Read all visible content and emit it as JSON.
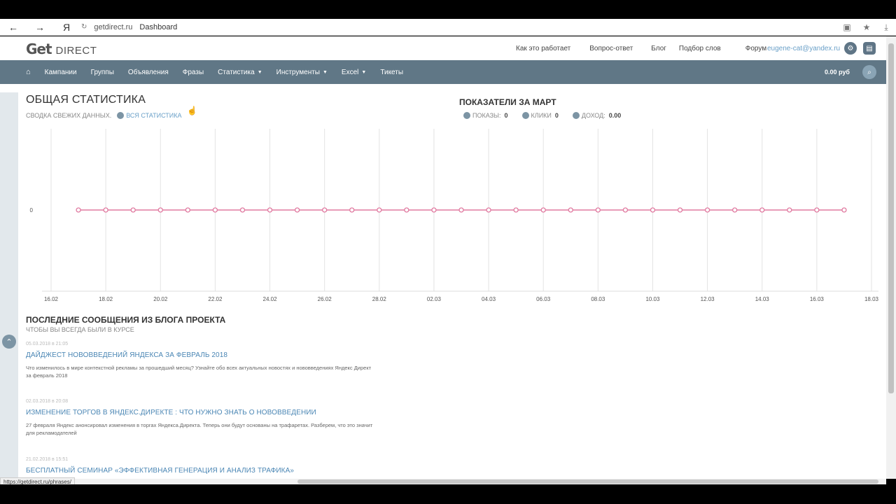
{
  "browser": {
    "back": "←",
    "forward": "→",
    "yandex": "Я",
    "domain": "getdirect.ru",
    "page_title": "Dashboard"
  },
  "logo": {
    "get": "Get",
    "direct": "DIRECT"
  },
  "toplinks": [
    "Как это работает",
    "Вопрос-ответ",
    "Блог",
    "Подбор слов",
    "Форум"
  ],
  "user_email": "eugene-cat@yandex.ru",
  "nav": {
    "items": [
      "Кампании",
      "Группы",
      "Объявления",
      "Фразы",
      "Статистика",
      "Инструменты",
      "Excel",
      "Тикеты"
    ],
    "balance": "0.00 руб"
  },
  "overview": {
    "title": "ОБЩАЯ СТАТИСТИКА",
    "subtitle": "СВОДКА СВЕЖИХ ДАННЫХ.",
    "all_stats_link": "ВСЯ СТАТИСТИКА"
  },
  "march": {
    "title": "ПОКАЗАТЕЛИ ЗА МАРТ",
    "shows_label": "ПОКАЗЫ:",
    "shows_value": "0",
    "clicks_label": "КЛИКИ",
    "clicks_value": "0",
    "income_label": "ДОХОД:",
    "income_value": "0.00"
  },
  "chart_data": {
    "type": "line",
    "x_ticks": [
      "16.02",
      "18.02",
      "20.02",
      "22.02",
      "24.02",
      "26.02",
      "28.02",
      "02.03",
      "04.03",
      "06.03",
      "08.03",
      "10.03",
      "12.03",
      "14.03",
      "16.03",
      "18.03"
    ],
    "x": [
      "17.02",
      "18.02",
      "19.02",
      "20.02",
      "21.02",
      "22.02",
      "23.02",
      "24.02",
      "25.02",
      "26.02",
      "27.02",
      "28.02",
      "01.03",
      "02.03",
      "03.03",
      "04.03",
      "05.03",
      "06.03",
      "07.03",
      "08.03",
      "09.03",
      "10.03",
      "11.03",
      "12.03",
      "13.03",
      "14.03",
      "15.03",
      "16.03",
      "17.03"
    ],
    "values": [
      0,
      0,
      0,
      0,
      0,
      0,
      0,
      0,
      0,
      0,
      0,
      0,
      0,
      0,
      0,
      0,
      0,
      0,
      0,
      0,
      0,
      0,
      0,
      0,
      0,
      0,
      0,
      0,
      0
    ],
    "y_ticks": [
      "0"
    ],
    "ylim": [
      -1,
      1
    ],
    "grid": true,
    "line_color": "#e07aa0"
  },
  "blog": {
    "title": "ПОСЛЕДНИЕ СООБЩЕНИЯ ИЗ БЛОГА ПРОЕКТА",
    "subtitle": "ЧТОБЫ ВЫ ВСЕГДА БЫЛИ В КУРСЕ",
    "posts": [
      {
        "date": "05.03.2018 в 21:05",
        "title": "ДАЙДЖЕСТ НОВОВВЕДЕНИЙ ЯНДЕКСА ЗА ФЕВРАЛЬ 2018",
        "text": "Что изменилось в мире контекстной рекламы за прошедший месяц? Узнайте обо всех актуальных новостях и нововведениях Яндекс Директ за февраль 2018"
      },
      {
        "date": "02.03.2018 в 20:08",
        "title": "ИЗМЕНЕНИЕ ТОРГОВ В ЯНДЕКС.ДИРЕКТЕ : ЧТО НУЖНО ЗНАТЬ О НОВОВВЕДЕНИИ",
        "text": "27 февраля Яндекс анонсировал изменения в торгах Яндекса.Директа. Теперь они будут основаны на трафаретах. Разберем, что это значит для рекламодателей"
      },
      {
        "date": "21.02.2018 в 15:51",
        "title": "БЕСПЛАТНЫЙ СЕМИНАР «ЭФФЕКТИВНАЯ ГЕНЕРАЦИЯ И АНАЛИЗ ТРАФИКА»",
        "text": ""
      }
    ]
  },
  "status_url": "https://getdirect.ru/phrases/"
}
